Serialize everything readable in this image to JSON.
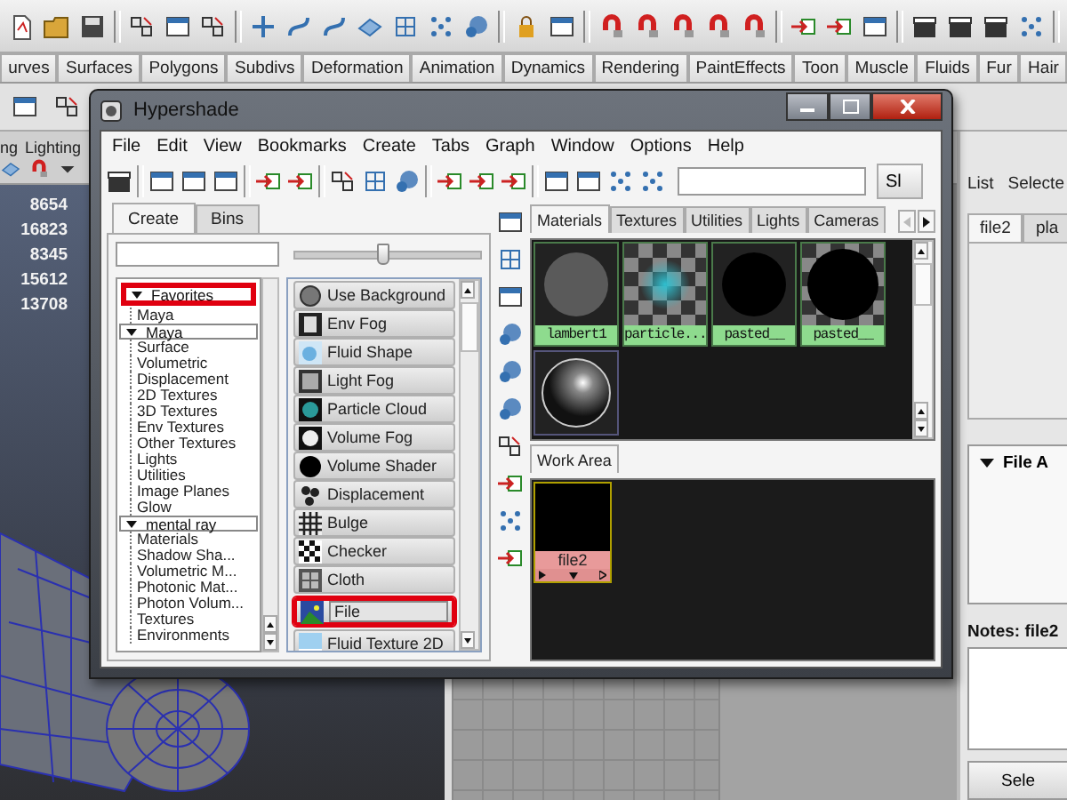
{
  "shelf": {
    "tabs": [
      "urves",
      "Surfaces",
      "Polygons",
      "Subdivs",
      "Deformation",
      "Animation",
      "Dynamics",
      "Rendering",
      "PaintEffects",
      "Toon",
      "Muscle",
      "Fluids",
      "Fur",
      "Hair"
    ]
  },
  "viewport": {
    "menu": [
      "ng",
      "Lighting"
    ],
    "stats": [
      "8654",
      "16823",
      "8345",
      "15612",
      "13708"
    ]
  },
  "side_panel": {
    "header": [
      "List",
      "Selecte"
    ],
    "tabs": [
      {
        "label": "file2",
        "selected": true
      },
      {
        "label": "pla",
        "selected": false
      }
    ],
    "section": "File A",
    "notes_label": "Notes: file2",
    "button": "Sele"
  },
  "hypershade": {
    "title": "Hypershade",
    "menu": [
      "File",
      "Edit",
      "View",
      "Bookmarks",
      "Create",
      "Tabs",
      "Graph",
      "Window",
      "Options",
      "Help"
    ],
    "toolbar_button": "Sl",
    "create_tabs": [
      {
        "label": "Create",
        "selected": true
      },
      {
        "label": "Bins",
        "selected": false
      }
    ],
    "filter_slider": {
      "level": 0.48
    },
    "tree": [
      {
        "label": "Favorites",
        "expanded": true,
        "highlighted": true,
        "children": [
          {
            "label": "Maya"
          }
        ]
      },
      {
        "label": "Maya",
        "expanded": true,
        "highlighted": false,
        "children": [
          {
            "label": "Surface"
          },
          {
            "label": "Volumetric"
          },
          {
            "label": "Displacement"
          },
          {
            "label": "2D Textures"
          },
          {
            "label": "3D Textures"
          },
          {
            "label": "Env Textures"
          },
          {
            "label": "Other Textures"
          },
          {
            "label": "Lights"
          },
          {
            "label": "Utilities"
          },
          {
            "label": "Image Planes"
          },
          {
            "label": "Glow"
          }
        ]
      },
      {
        "label": "mental ray",
        "expanded": true,
        "highlighted": false,
        "children": [
          {
            "label": "Materials"
          },
          {
            "label": "Shadow Sha..."
          },
          {
            "label": "Volumetric M..."
          },
          {
            "label": "Photonic Mat..."
          },
          {
            "label": "Photon Volum..."
          },
          {
            "label": "Textures"
          },
          {
            "label": "Environments"
          }
        ]
      }
    ],
    "nodes": [
      {
        "label": "Use Background",
        "kind": "disc",
        "selected": false,
        "highlighted": false
      },
      {
        "label": "Env Fog",
        "kind": "film",
        "selected": false,
        "highlighted": false
      },
      {
        "label": "Fluid Shape",
        "kind": "cloud",
        "selected": false,
        "highlighted": false
      },
      {
        "label": "Light Fog",
        "kind": "haze",
        "selected": false,
        "highlighted": false
      },
      {
        "label": "Particle Cloud",
        "kind": "teal",
        "selected": false,
        "highlighted": false
      },
      {
        "label": "Volume Fog",
        "kind": "glow",
        "selected": false,
        "highlighted": false
      },
      {
        "label": "Volume Shader",
        "kind": "black",
        "selected": false,
        "highlighted": false
      },
      {
        "label": "Displacement",
        "kind": "blobs",
        "selected": false,
        "highlighted": false
      },
      {
        "label": "Bulge",
        "kind": "grid",
        "selected": false,
        "highlighted": false
      },
      {
        "label": "Checker",
        "kind": "checker",
        "selected": false,
        "highlighted": false
      },
      {
        "label": "Cloth",
        "kind": "weave",
        "selected": false,
        "highlighted": false
      },
      {
        "label": "File",
        "kind": "landscape",
        "selected": true,
        "highlighted": true
      },
      {
        "label": "Fluid Texture 2D",
        "kind": "sky",
        "selected": false,
        "highlighted": false
      }
    ],
    "browser_tabs": [
      {
        "label": "Materials",
        "selected": true
      },
      {
        "label": "Textures",
        "selected": false
      },
      {
        "label": "Utilities",
        "selected": false
      },
      {
        "label": "Lights",
        "selected": false
      },
      {
        "label": "Cameras",
        "selected": false
      }
    ],
    "swatches": [
      {
        "label": "lambert1",
        "kind": "matte"
      },
      {
        "label": "particle...",
        "kind": "checker-glow"
      },
      {
        "label": "pasted__",
        "kind": "dark"
      },
      {
        "label": "pasted__",
        "kind": "checker-dark"
      },
      {
        "kind": "glossy"
      }
    ],
    "work_tabs": [
      {
        "label": "Work Area",
        "selected": true
      }
    ],
    "work_nodes": [
      {
        "label": "file2"
      }
    ]
  }
}
